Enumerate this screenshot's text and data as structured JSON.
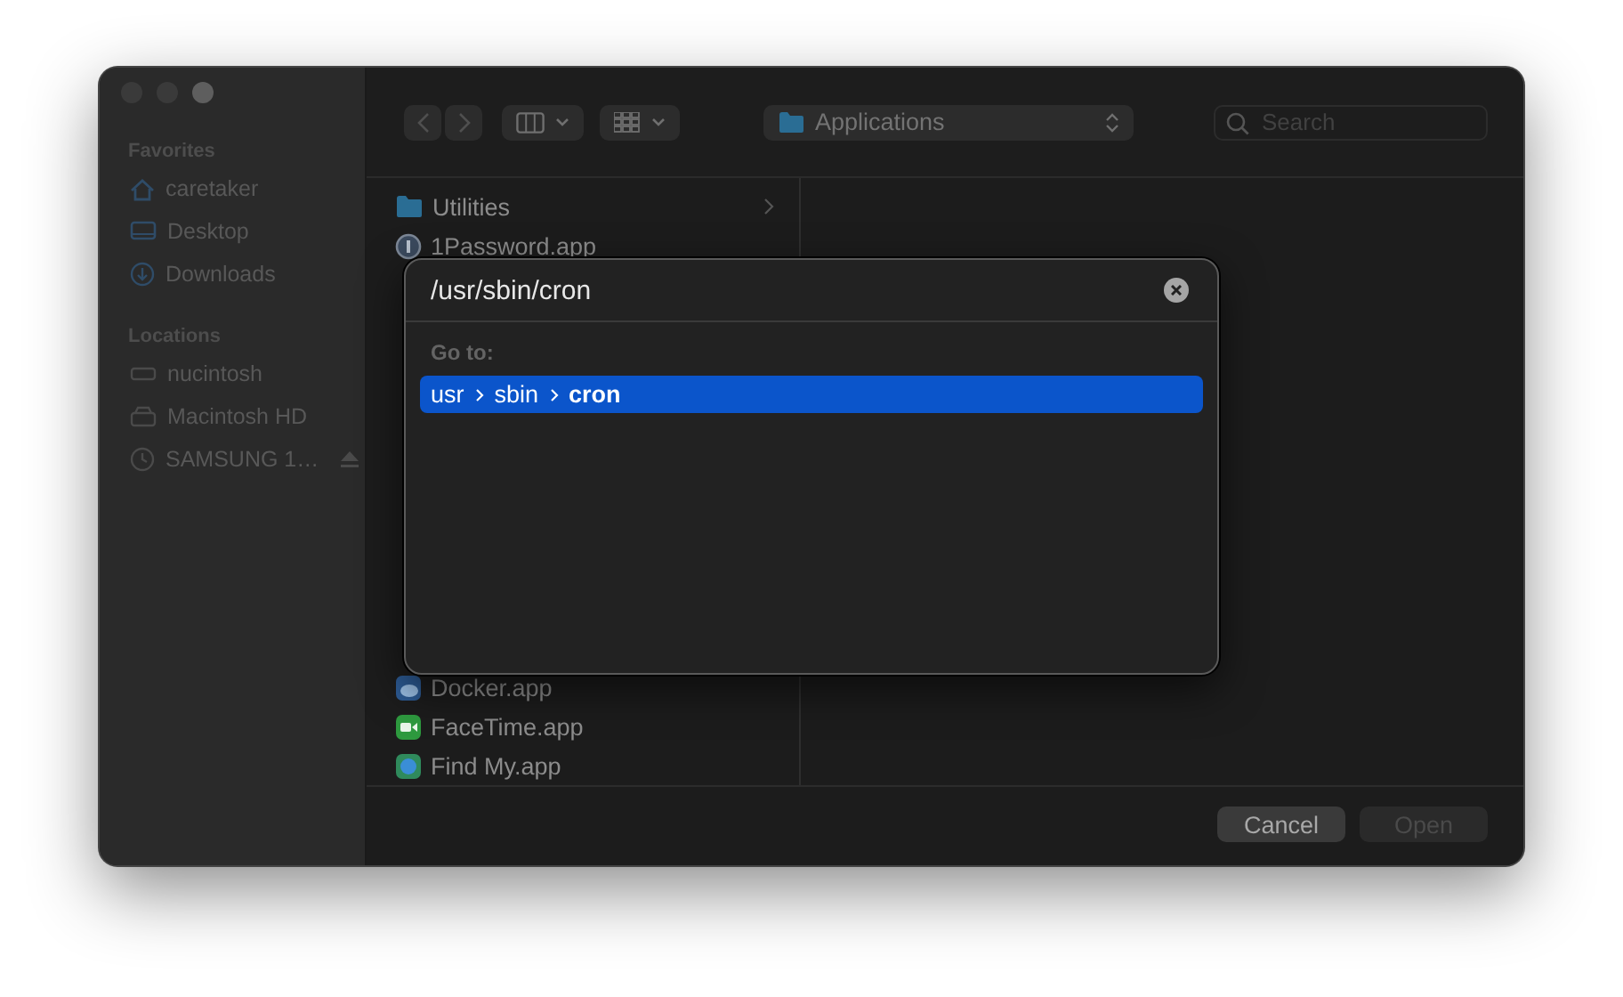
{
  "sidebar": {
    "sections": [
      {
        "title": "Favorites",
        "items": [
          {
            "label": "caretaker",
            "ejectable": false
          },
          {
            "label": "Desktop",
            "ejectable": false
          },
          {
            "label": "Downloads",
            "ejectable": false
          }
        ]
      },
      {
        "title": "Locations",
        "items": [
          {
            "label": "nucintosh",
            "ejectable": false
          },
          {
            "label": "Macintosh HD",
            "ejectable": false
          },
          {
            "label": "SAMSUNG 1…",
            "ejectable": true
          }
        ]
      }
    ]
  },
  "toolbar": {
    "location": "Applications",
    "search": {
      "placeholder": "Search"
    }
  },
  "file_column": {
    "top_items": [
      {
        "label": "Utilities",
        "folder": true
      },
      {
        "label": "1Password.app",
        "folder": false
      }
    ],
    "bottom_items": [
      {
        "label": "Docker.app",
        "folder": false
      },
      {
        "label": "FaceTime.app",
        "folder": false
      },
      {
        "label": "Find My.app",
        "folder": false
      }
    ]
  },
  "goto_dialog": {
    "path": "/usr/sbin/cron",
    "section": "Go to:",
    "results": [
      {
        "selected": true,
        "segments": [
          {
            "text": "usr",
            "bold": false
          },
          {
            "text": "sbin",
            "bold": false
          },
          {
            "text": "cron",
            "bold": true
          }
        ]
      }
    ]
  },
  "buttons": [
    {
      "label": "Cancel",
      "disabled": false
    },
    {
      "label": "Open",
      "disabled": true
    }
  ]
}
